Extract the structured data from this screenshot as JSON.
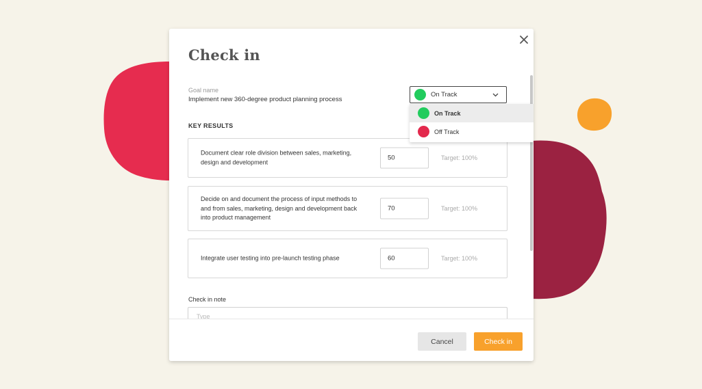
{
  "colors": {
    "background": "#f6f3e9",
    "accent_orange": "#f8a12c",
    "on_track_green": "#22cc5e",
    "off_track_red": "#e3294d",
    "blob_red": "#e62c4f",
    "blob_maroon": "#9b2241",
    "blob_orange": "#f8a12c"
  },
  "modal": {
    "title": "Check in",
    "close_icon": "close-icon",
    "goal": {
      "label": "Goal name",
      "value": "Implement new 360-degree product planning process"
    },
    "status": {
      "selected": "On Track",
      "options": [
        {
          "label": "On Track",
          "color": "#22cc5e",
          "active": true
        },
        {
          "label": "Off Track",
          "color": "#e3294d",
          "active": false
        }
      ]
    },
    "key_results": {
      "title": "KEY RESULTS",
      "items": [
        {
          "text": "Document clear role division between sales, marketing, design and development",
          "value": "50",
          "target": "Target: 100%"
        },
        {
          "text": "Decide on and document the process of input methods to and from sales, marketing, design and development back into product management",
          "value": "70",
          "target": "Target: 100%"
        },
        {
          "text": "Integrate user testing into pre-launch testing phase",
          "value": "60",
          "target": "Target: 100%"
        }
      ]
    },
    "note": {
      "label": "Check in note",
      "placeholder": "Type"
    },
    "footer": {
      "cancel_label": "Cancel",
      "checkin_label": "Check in"
    }
  }
}
